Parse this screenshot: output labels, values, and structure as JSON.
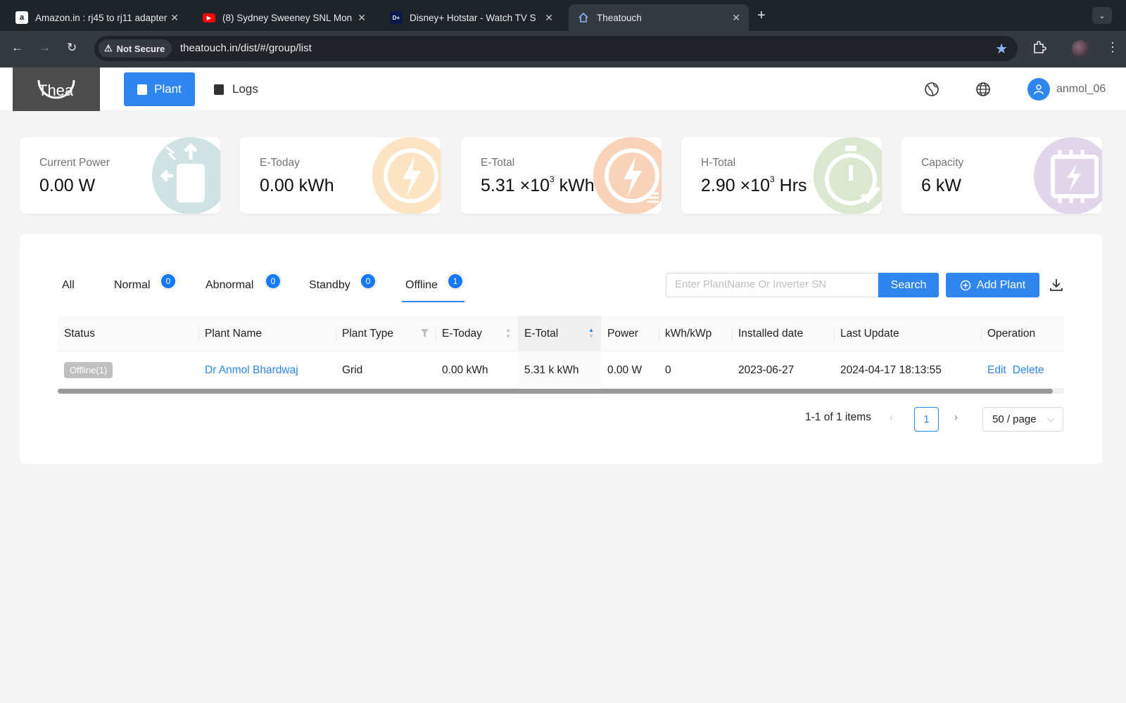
{
  "browser": {
    "tabs": [
      {
        "title": "Amazon.in : rj45 to rj11 adapter",
        "icon": "amazon-icon"
      },
      {
        "title": "(8) Sydney Sweeney SNL Mon",
        "icon": "youtube-icon"
      },
      {
        "title": "Disney+ Hotstar - Watch TV S",
        "icon": "hotstar-icon"
      },
      {
        "title": "Theatouch",
        "icon": "home-icon"
      }
    ],
    "security_label": "Not Secure",
    "url": "theatouch.in/dist/#/group/list"
  },
  "header": {
    "logo_text": "Thea",
    "nav": {
      "plant": "Plant",
      "logs": "Logs"
    },
    "username": "anmol_06"
  },
  "stats": [
    {
      "label": "Current Power",
      "value": "0.00 W",
      "icon": "inverter-icon",
      "color": "#cfe3e4"
    },
    {
      "label": "E-Today",
      "value": "0.00 kWh",
      "icon": "lightning-icon",
      "color": "#fbe3c4"
    },
    {
      "label": "E-Total",
      "value_main": "5.31 ×10",
      "value_exp": "3",
      "value_unit": "kWh",
      "icon": "lightning-meter-icon",
      "color": "#f9d3b9"
    },
    {
      "label": "H-Total",
      "value_main": "2.90 ×10",
      "value_exp": "3",
      "value_unit": "Hrs",
      "icon": "stopwatch-icon",
      "color": "#dbe8cf"
    },
    {
      "label": "Capacity",
      "value": "6 kW",
      "icon": "battery-icon",
      "color": "#e1d5e9"
    }
  ],
  "filters": [
    {
      "label": "All"
    },
    {
      "label": "Normal",
      "count": "0"
    },
    {
      "label": "Abnormal",
      "count": "0"
    },
    {
      "label": "Standby",
      "count": "0"
    },
    {
      "label": "Offline",
      "count": "1",
      "active": true
    }
  ],
  "search": {
    "placeholder": "Enter PlantName Or Inverter SN",
    "button": "Search"
  },
  "add_plant_label": "Add Plant",
  "table": {
    "columns": [
      "Status",
      "Plant Name",
      "Plant Type",
      "E-Today",
      "E-Total",
      "Power",
      "kWh/kWp",
      "Installed date",
      "Last Update",
      "Operation"
    ],
    "rows": [
      {
        "status": "Offline(1)",
        "name": "Dr Anmol Bhardwaj",
        "type": "Grid",
        "e_today": "0.00 kWh",
        "e_total": "5.31 k kWh",
        "power": "0.00 W",
        "kwh_kwp": "0",
        "installed": "2023-06-27",
        "last_update": "2024-04-17 18:13:55",
        "edit": "Edit",
        "delete": "Delete"
      }
    ]
  },
  "pagination": {
    "summary": "1-1 of 1 items",
    "current": "1",
    "page_size": "50 / page"
  },
  "colors": {
    "accent": "#2f86ee",
    "badge": "#1677ff",
    "offline_tag": "#bfbfbf"
  }
}
